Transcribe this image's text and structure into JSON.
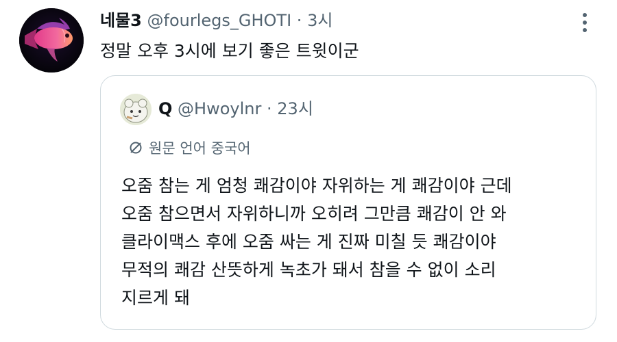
{
  "tweet": {
    "display_name": "네물3",
    "handle": "@fourlegs_GHOTI",
    "separator": "·",
    "time": "3시",
    "text": "정말 오후 3시에 보기 좋은 트윗이군",
    "avatar_icon": "pink-fish-avatar",
    "more_icon": "more-vertical-icon"
  },
  "quote": {
    "display_name": "Q",
    "handle": "@Hwoylnr",
    "separator": "·",
    "time": "23시",
    "avatar_icon": "cartoon-character-avatar",
    "translate_icon": "translate-icon",
    "translate_label": "원문 언어 중국어",
    "lines": [
      "오줌 참는 게 엄청 쾌감이야 자위하는 게 쾌감이야 근데",
      "오줌 참으면서 자위하니까 오히려 그만큼 쾌감이 안 와",
      "클라이맥스 후에 오줌 싸는 게 진짜 미칠 듯 쾌감이야",
      "무적의 쾌감 산뜻하게 녹초가 돼서 참을 수 없이 소리",
      "지르게 돼"
    ]
  },
  "colors": {
    "text_primary": "#0f1419",
    "text_secondary": "#536471",
    "card_border": "#cfd9de"
  }
}
